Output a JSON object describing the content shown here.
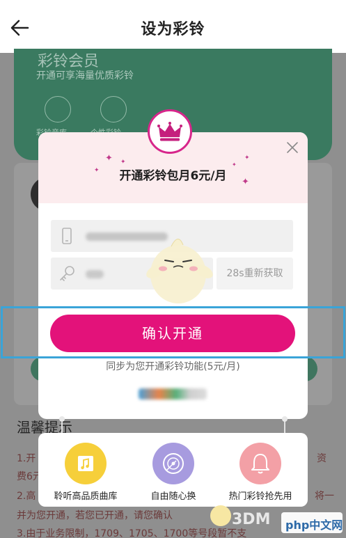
{
  "topbar": {
    "title": "设为彩铃"
  },
  "background": {
    "green_title": "彩铃会员",
    "green_subtitle": "开通可享海量优质彩铃",
    "green_labels": [
      "彩铃音库",
      "个性彩铃"
    ],
    "tips_title": "温馨提示",
    "tips_lines": [
      "1.开",
      "费6元",
      "2.高",
      "并为您开通，若您已开通，请您确认",
      "3.由于业务限制，1709、1705、1700等号段暂不支"
    ],
    "tips_right": [
      "资",
      "将一"
    ]
  },
  "modal": {
    "title": "开通彩铃包月6元/月",
    "resend_label": "28s重新获取",
    "confirm_label": "确认开通",
    "sync_text": "同步为您开通彩铃功能(5元/月)"
  },
  "benefits": [
    {
      "label": "聆听高品质曲库",
      "icon": "music-folder-icon",
      "color": "#f6cf3a"
    },
    {
      "label": "自由随心换",
      "icon": "vinyl-disc-icon",
      "color": "#a79bdf"
    },
    {
      "label": "热门彩铃抢先用",
      "icon": "bell-icon",
      "color": "#f3a0a6"
    }
  ],
  "watermark": {
    "text": "3DM",
    "php_text": "php中文网"
  },
  "colors": {
    "accent": "#e3127a",
    "highlight": "#3aa4d8",
    "modal_head": "#fcecee"
  }
}
